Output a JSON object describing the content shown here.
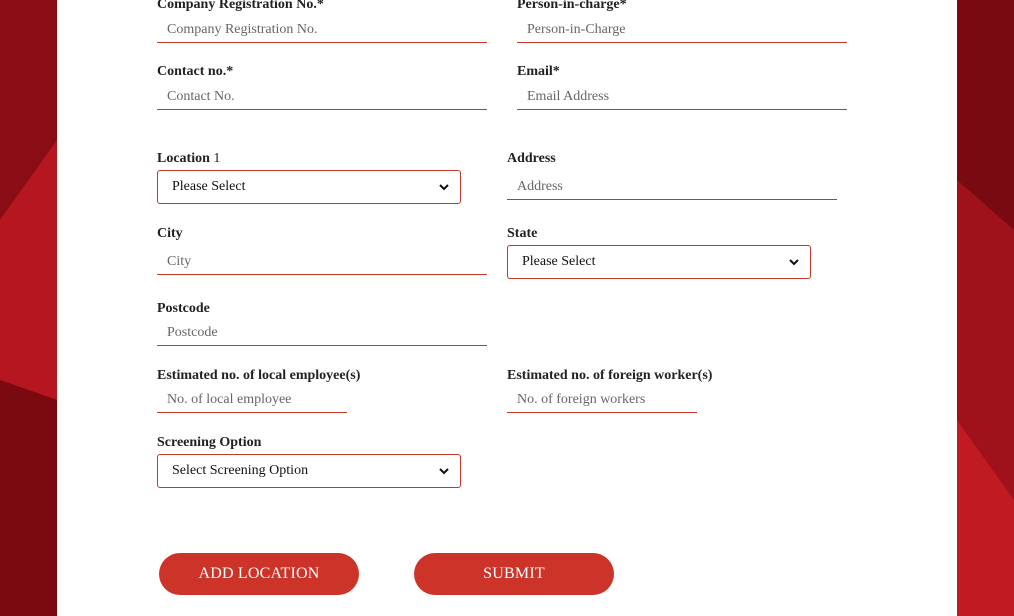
{
  "form": {
    "company_reg": {
      "label": "Company Registration No.*",
      "placeholder": "Company Registration No."
    },
    "person_in_charge": {
      "label": "Person-in-charge*",
      "placeholder": "Person-in-Charge"
    },
    "contact": {
      "label": "Contact no.*",
      "placeholder": "Contact No."
    },
    "email": {
      "label": "Email*",
      "placeholder": "Email Address"
    },
    "location": {
      "label": "Location",
      "number": "1",
      "selected": "Please Select"
    },
    "address": {
      "label": "Address",
      "placeholder": "Address"
    },
    "city": {
      "label": "City",
      "placeholder": "City"
    },
    "state": {
      "label": "State",
      "selected": "Please Select"
    },
    "postcode": {
      "label": "Postcode",
      "placeholder": "Postcode"
    },
    "local_employee": {
      "label": "Estimated no. of local employee(s)",
      "placeholder": "No. of local employee"
    },
    "foreign_workers": {
      "label": "Estimated no. of foreign worker(s)",
      "placeholder": "No. of foreign workers"
    },
    "screening": {
      "label": "Screening Option",
      "selected": "Select Screening Option"
    }
  },
  "buttons": {
    "add_location": "ADD LOCATION",
    "submit": "SUBMIT"
  },
  "colors": {
    "accent": "#cc3329",
    "field_border": "#c0392b",
    "background": "#9a0f18"
  },
  "icons": {
    "select_arrow": "chevron-down-icon"
  }
}
